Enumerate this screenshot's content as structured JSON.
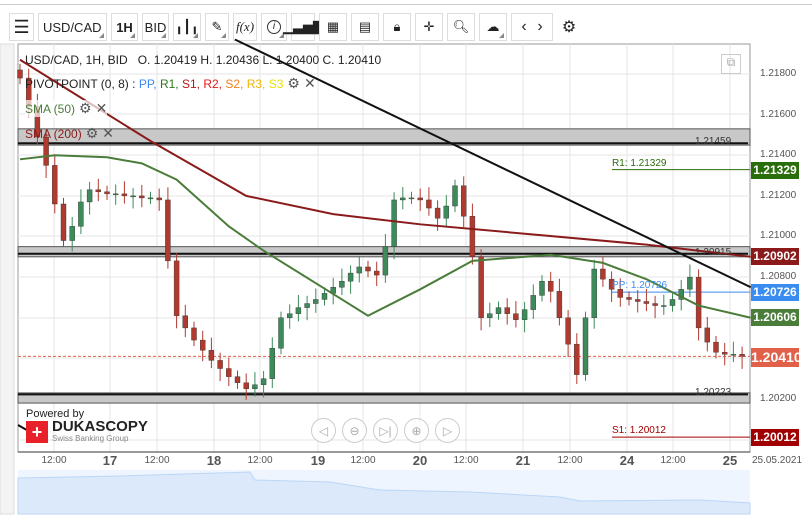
{
  "toolbar": {
    "menu_icon": "hamburger-icon",
    "symbol": "USD/CAD",
    "period": "1H",
    "side": "BID",
    "buttons": [
      "candles-icon",
      "pencil-icon",
      "fx-icon",
      "info-icon",
      "volume-icon",
      "calendar-icon",
      "report-icon",
      "lock-icon",
      "crosshair-icon",
      "zoom-icon",
      "upload-icon",
      "prev-icon",
      "next-icon",
      "gear-icon"
    ],
    "fx_label": "f(x)",
    "info_label": "i"
  },
  "header": {
    "info": "USD/CAD, 1H, BID",
    "ohlc": "O. 1.20419 H. 1.20436 L. 1.20400 C. 1.20410"
  },
  "indicators": {
    "pivot": {
      "label": "PIVOTPOINT (0, 8)",
      "sep": " : ",
      "items": [
        {
          "t": "PP",
          "c": "#3d8af7"
        },
        {
          "t": "R1",
          "c": "#2a7a1a"
        },
        {
          "t": "S1",
          "c": "#b01818"
        },
        {
          "t": "R2",
          "c": "#e31b1b"
        },
        {
          "t": "S2",
          "c": "#f0801a"
        },
        {
          "t": "R3",
          "c": "#f2b400"
        },
        {
          "t": "S3",
          "c": "#e8e000"
        }
      ]
    },
    "sma50": {
      "label": "SMA (50)",
      "color": "#4a7c3a"
    },
    "sma200": {
      "label": "SMA (200)",
      "color": "#8b1a1a"
    }
  },
  "price_axis": {
    "ticks": [
      "1.21800",
      "1.21600",
      "1.21400",
      "1.21200",
      "1.21000",
      "1.20800",
      "1.20200"
    ],
    "labels": [
      {
        "text": "1.21329",
        "color": "#2a6e0c"
      },
      {
        "text": "1.20902",
        "color": "#8b1a1a"
      },
      {
        "text": "1.20726",
        "color": "#3b8cf0"
      },
      {
        "text": "1.20606",
        "color": "#4a7c3a"
      },
      {
        "text": "1.20410",
        "color": "#e0604a"
      },
      {
        "text": "1.20012",
        "color": "#a00000"
      }
    ]
  },
  "levels": [
    {
      "text": "1.21459",
      "price": 1.21459,
      "band": [
        1.2145,
        1.2153
      ]
    },
    {
      "text": "1.20915",
      "price": 1.20915,
      "band": [
        1.209,
        1.2095
      ]
    },
    {
      "text": "1.20223",
      "price": 1.20223,
      "band": [
        1.2018,
        1.2023
      ]
    }
  ],
  "pivots": [
    {
      "label": "R1: 1.21329",
      "price": 1.21329,
      "color": "#2a6e0c"
    },
    {
      "label": "PP: 1.20726",
      "price": 1.20726,
      "color": "#3b8cf0"
    },
    {
      "label": "S1: 1.20012",
      "price": 1.20012,
      "color": "#a00000"
    }
  ],
  "time_axis": [
    {
      "t": "12:00",
      "d": 0
    },
    {
      "t": "17",
      "d": 1
    },
    {
      "t": "12:00",
      "d": 0
    },
    {
      "t": "18",
      "d": 1
    },
    {
      "t": "12:00",
      "d": 0
    },
    {
      "t": "19",
      "d": 1
    },
    {
      "t": "12:00",
      "d": 0
    },
    {
      "t": "20",
      "d": 1
    },
    {
      "t": "12:00",
      "d": 0
    },
    {
      "t": "21",
      "d": 1
    },
    {
      "t": "12:00",
      "d": 0
    },
    {
      "t": "24",
      "d": 1
    },
    {
      "t": "12:00",
      "d": 0
    },
    {
      "t": "25",
      "d": 1
    }
  ],
  "date": "25.05.2021",
  "branding": {
    "powered": "Powered by",
    "name": "DUKASCOPY",
    "sub": "Swiss Banking Group"
  },
  "nav_buttons": [
    "scroll-left-icon",
    "zoom-out-icon",
    "scroll-end-icon",
    "zoom-in-icon",
    "scroll-right-icon"
  ],
  "chart_data": {
    "type": "candlestick",
    "symbol": "USD/CAD",
    "interval": "2H bars (approx.)",
    "ylim": [
      1.1995,
      1.2195
    ],
    "close": [
      1.2178,
      1.2164,
      1.2149,
      1.2135,
      1.2116,
      1.2098,
      1.2105,
      1.2117,
      1.2123,
      1.2122,
      1.2121,
      1.2121,
      1.212,
      1.212,
      1.2119,
      1.2119,
      1.2118,
      1.2088,
      1.2061,
      1.2055,
      1.2049,
      1.2044,
      1.2039,
      1.2035,
      1.2031,
      1.2028,
      1.2025,
      1.2027,
      1.203,
      1.2045,
      1.206,
      1.2062,
      1.2065,
      1.2067,
      1.2069,
      1.2072,
      1.2075,
      1.2078,
      1.2082,
      1.2085,
      1.2083,
      1.2081,
      1.2095,
      1.2118,
      1.2119,
      1.2119,
      1.2118,
      1.2114,
      1.2109,
      1.2115,
      1.2125,
      1.211,
      1.209,
      1.206,
      1.2062,
      1.2065,
      1.2062,
      1.2059,
      1.2064,
      1.2071,
      1.2078,
      1.2073,
      1.206,
      1.2047,
      1.2032,
      1.206,
      1.2084,
      1.2079,
      1.2074,
      1.207,
      1.2069,
      1.2068,
      1.2067,
      1.2066,
      1.2066,
      1.2069,
      1.2074,
      1.208,
      1.2055,
      1.2048,
      1.2043,
      1.2042,
      1.2042,
      1.2041
    ],
    "sma200": [
      [
        0,
        1.2187
      ],
      [
        15,
        1.2147
      ],
      [
        26,
        1.212
      ],
      [
        36,
        1.2111
      ],
      [
        46,
        1.2106
      ],
      [
        59,
        1.2101
      ],
      [
        72,
        1.2096
      ],
      [
        84,
        1.209
      ]
    ],
    "sma50": [
      [
        0,
        1.2138
      ],
      [
        4,
        1.214
      ],
      [
        10,
        1.2139
      ],
      [
        14,
        1.2136
      ],
      [
        18,
        1.2128
      ],
      [
        24,
        1.2105
      ],
      [
        28,
        1.2093
      ],
      [
        37,
        1.2069
      ],
      [
        40,
        1.2061
      ],
      [
        46,
        1.2074
      ],
      [
        52,
        1.2088
      ],
      [
        61,
        1.2091
      ],
      [
        67,
        1.2087
      ],
      [
        72,
        1.2079
      ],
      [
        78,
        1.2066
      ],
      [
        84,
        1.206
      ]
    ],
    "trendline": [
      [
        24.7,
        1.2197
      ],
      [
        84,
        1.2075
      ]
    ],
    "last": 1.2041
  }
}
